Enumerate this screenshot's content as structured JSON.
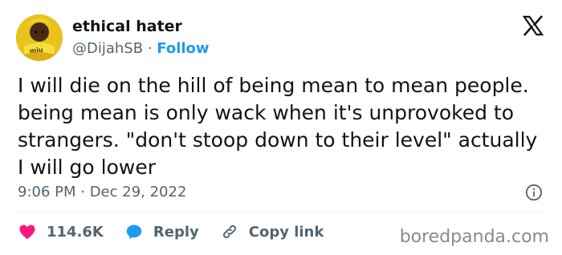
{
  "author": {
    "display_name": "ethical hater",
    "handle": "@DijahSB",
    "separator": "·",
    "follow_label": "Follow",
    "avatar_text": "miu"
  },
  "tweet": {
    "text": "I will die on the hill of being mean to mean people. being mean is only wack when it's unprovoked to strangers. \"don't stoop down to their level\" actually I will go lower",
    "timestamp": "9:06 PM · Dec 29, 2022"
  },
  "actions": {
    "likes_count": "114.6K",
    "reply_label": "Reply",
    "copy_link_label": "Copy link"
  },
  "watermark": "boredpanda.com",
  "colors": {
    "like_heart": "#f91880",
    "reply_bubble": "#1d9bf0",
    "follow": "#1d9bf0",
    "secondary_text": "#536471"
  },
  "icons": [
    "x-logo-icon",
    "info-icon",
    "heart-icon",
    "reply-icon",
    "link-icon"
  ]
}
